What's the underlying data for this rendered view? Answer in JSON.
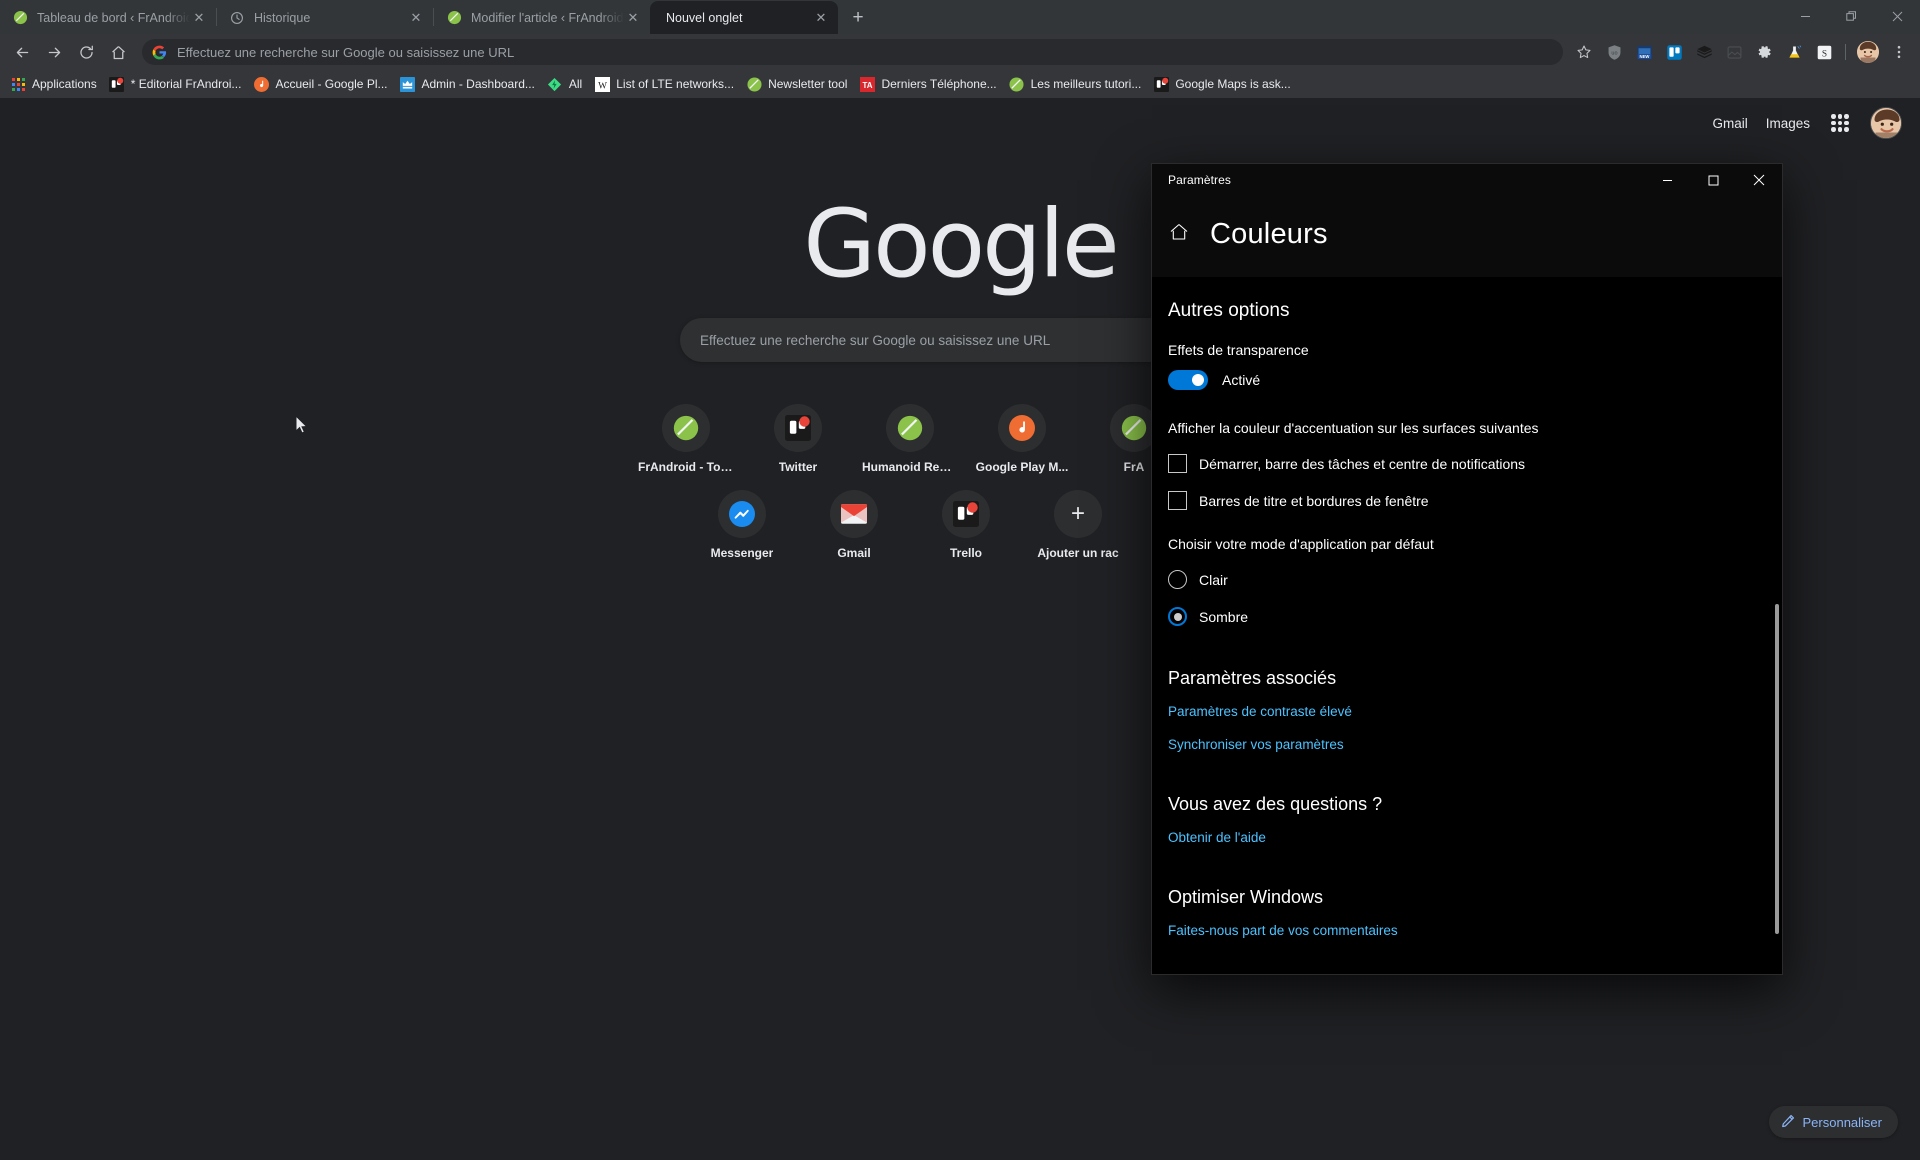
{
  "browser": {
    "tabs": [
      {
        "title": "Tableau de bord ‹ FrAndroid — W",
        "favicon": "frandroid-icon",
        "active": false,
        "close_label": "✕"
      },
      {
        "title": "Historique",
        "favicon": "history-icon",
        "active": false,
        "close_label": "✕"
      },
      {
        "title": "Modifier l'article ‹ FrAndroid — W",
        "favicon": "frandroid-icon",
        "active": false,
        "close_label": "✕"
      },
      {
        "title": "Nouvel onglet",
        "favicon": "none",
        "active": true,
        "close_label": "✕"
      }
    ],
    "new_tab_button": "+",
    "window_controls": {
      "minimize": "minimize-icon",
      "restore": "restore-icon",
      "close": "close-icon"
    },
    "nav": {
      "back": "back-arrow-icon",
      "forward": "forward-arrow-icon",
      "reload": "reload-icon",
      "home": "home-icon"
    },
    "omnibox": {
      "text": "Effectuez une recherche sur Google ou saisissez une URL",
      "leading_icon": "google-g-icon",
      "star": "bookmark-star-icon"
    },
    "toolbar_icons": [
      "ublock-origin-icon",
      "new-badge-extension-icon",
      "trello-extension-icon",
      "buffer-extension-icon",
      "image-extension-icon",
      "gear-extension-icon",
      "flask-extension-icon",
      "s-extension-icon"
    ],
    "menu_icon": "three-dot-menu-icon",
    "bookmarks": [
      {
        "label": "Applications",
        "icon": "apps-grid-icon"
      },
      {
        "label": "* Editorial FrAndroi...",
        "icon": "trello-icon"
      },
      {
        "label": "Accueil - Google Pl...",
        "icon": "google-play-music-icon"
      },
      {
        "label": "Admin - Dashboard...",
        "icon": "admin-dashboard-icon"
      },
      {
        "label": "All",
        "icon": "green-diamond-icon"
      },
      {
        "label": "List of LTE networks...",
        "icon": "wikipedia-icon"
      },
      {
        "label": "Newsletter tool",
        "icon": "frandroid-icon"
      },
      {
        "label": "Derniers Téléphone...",
        "icon": "ta-icon"
      },
      {
        "label": "Les meilleurs tutori...",
        "icon": "frandroid-icon"
      },
      {
        "label": "Google Maps is ask...",
        "icon": "trello-icon"
      }
    ]
  },
  "newtab": {
    "header_links": [
      "Gmail",
      "Images"
    ],
    "apps_icon": "google-apps-grid-icon",
    "avatar": "user-avatar",
    "logo_text": "Google",
    "fakebox_placeholder": "Effectuez une recherche sur Google ou saisissez une URL",
    "tiles": [
      {
        "label": "FrAndroid - Tou...",
        "icon": "frandroid-icon"
      },
      {
        "label": "Twitter",
        "icon": "trello-icon"
      },
      {
        "label": "Humanoid Real...",
        "icon": "frandroid-icon"
      },
      {
        "label": "Google Play M...",
        "icon": "google-play-music-icon"
      },
      {
        "label": "FrA",
        "icon": "frandroid-icon"
      },
      {
        "label": "Messenger",
        "icon": "messenger-icon"
      },
      {
        "label": "Gmail",
        "icon": "gmail-icon"
      },
      {
        "label": "Trello",
        "icon": "trello-icon"
      },
      {
        "label": "Ajouter un rac",
        "icon": "plus-icon"
      }
    ],
    "customize_button": {
      "label": "Personnaliser",
      "icon": "pencil-icon"
    }
  },
  "settings": {
    "window_title": "Paramètres",
    "window_controls": {
      "minimize": "−",
      "maximize": "☐",
      "close": "✕"
    },
    "home_icon": "home-icon",
    "page_title": "Couleurs",
    "sections": {
      "other_options_heading": "Autres options",
      "transparency_label": "Effets de transparence",
      "transparency_state": "Activé",
      "accent_surfaces_label": "Afficher la couleur d'accentuation sur les surfaces suivantes",
      "checkbox_start": "Démarrer, barre des tâches et centre de notifications",
      "checkbox_titlebars": "Barres de titre et bordures de fenêtre",
      "app_mode_label": "Choisir votre mode d'application par défaut",
      "radio_light": "Clair",
      "radio_dark": "Sombre",
      "related_heading": "Paramètres associés",
      "related_link_1": "Paramètres de contraste élevé",
      "related_link_2": "Synchroniser vos paramètres",
      "questions_heading": "Vous avez des questions ?",
      "help_link": "Obtenir de l'aide",
      "improve_heading": "Optimiser Windows",
      "feedback_link": "Faites-nous part de vos commentaires"
    }
  },
  "colors": {
    "accent_blue": "#0078d7",
    "link_blue": "#4cc2ff",
    "chrome_link_blue": "#8ab4f8",
    "chrome_toolbar": "#35363a",
    "chrome_tabstrip": "#323639",
    "ntp_background": "#202124"
  }
}
